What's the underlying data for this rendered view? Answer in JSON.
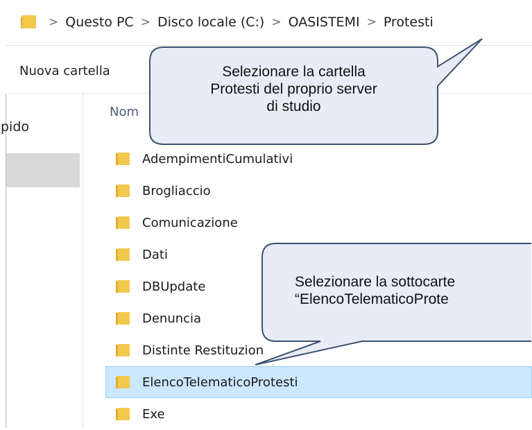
{
  "address_bar": {
    "icon": "folder-icon",
    "crumbs": [
      "Questo PC",
      "Disco locale (C:)",
      "OASISTEMI",
      "Protesti"
    ],
    "separator": ">"
  },
  "toolbar": {
    "new_folder_label": "Nuova cartella"
  },
  "nav": {
    "partial_label": "pido"
  },
  "header": {
    "name_label": "Nom"
  },
  "files": [
    {
      "name": "AdempimentiCumulativi"
    },
    {
      "name": "Brogliaccio"
    },
    {
      "name": "Comunicazione"
    },
    {
      "name": "Dati"
    },
    {
      "name": "DBUpdate"
    },
    {
      "name": "Denuncia"
    },
    {
      "name": "Distinte Restituzion"
    },
    {
      "name": "ElencoTelematicoProtesti",
      "selected": true
    },
    {
      "name": "Exe"
    }
  ],
  "callouts": {
    "top": {
      "line1": "Selezionare la cartella",
      "line2": "Protesti del proprio server",
      "line3": "di studio"
    },
    "bottom": {
      "line1": "Selezionare la sottocarte",
      "line2": "“ElencoTelematicoProte"
    }
  },
  "colors": {
    "folder": "#f2c94c",
    "selection": "#cce8ff",
    "selection_border": "#99d1ff",
    "callout_fill": "#e8ecf6",
    "callout_stroke": "#3d5170"
  }
}
